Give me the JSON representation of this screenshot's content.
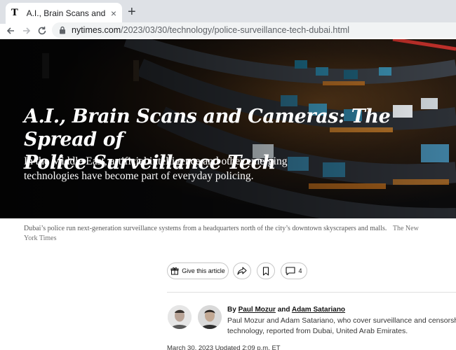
{
  "browser": {
    "tab_title": "A.I., Brain Scans and Cameras",
    "tab_favicon": "T",
    "new_tab": "+",
    "tab_close": "×",
    "url_host": "nytimes.com",
    "url_path": "/2023/03/30/technology/police-surveillance-tech-dubai.html"
  },
  "article": {
    "headline_line1": "A.I., Brain Scans and Cameras: The Spread of",
    "headline_line2": "Police Surveillance Tech",
    "dek_line1": "In the Middle East, artificial intelligence and other emerging",
    "dek_line2": "technologies have become part of everyday policing.",
    "caption": "Dubai’s police run next-generation surveillance systems from a headquarters north of the city’s downtown skyscrapers and malls.",
    "credit_line1": "The New",
    "credit_line2": "York Times",
    "give_label": "Give this article",
    "comment_count": "4",
    "byline_prefix": "By",
    "author1": "Paul Mozur",
    "byline_and": "and",
    "author2": "Adam Satariano",
    "bio_line1": "Paul Mozur and Adam Satariano, who cover surveillance and censorship",
    "bio_line2": "technology, reported from Dubai, United Arab Emirates.",
    "dateline": "March 30, 2023   Updated 2:09 p.m. ET"
  },
  "icons": {
    "back": "arrow-left-icon",
    "forward": "arrow-right-icon",
    "reload": "reload-icon",
    "lock": "lock-icon",
    "gift": "gift-icon",
    "share": "share-icon",
    "bookmark": "bookmark-icon",
    "comment": "comment-icon"
  }
}
